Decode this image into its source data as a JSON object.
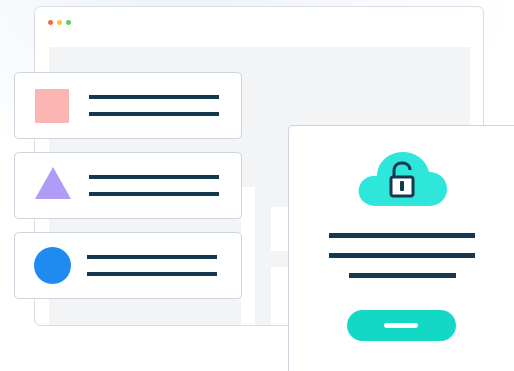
{
  "window": {
    "traffic_lights": [
      "#ee6a4d",
      "#f5c244",
      "#5ecb5b"
    ]
  },
  "list_cards": [
    {
      "icon": "square-icon",
      "color": "#fbb6b3"
    },
    {
      "icon": "triangle-icon",
      "color": "#b09cf6"
    },
    {
      "icon": "circle-icon",
      "color": "#1f8af0"
    }
  ],
  "panel": {
    "icon": "cloud-lock-icon",
    "cloud_color": "#2ee6da",
    "button_color": "#14d8c6"
  },
  "colors": {
    "text_line": "#14384f",
    "border": "#cfd5de",
    "content_bg": "#f3f4f6"
  }
}
